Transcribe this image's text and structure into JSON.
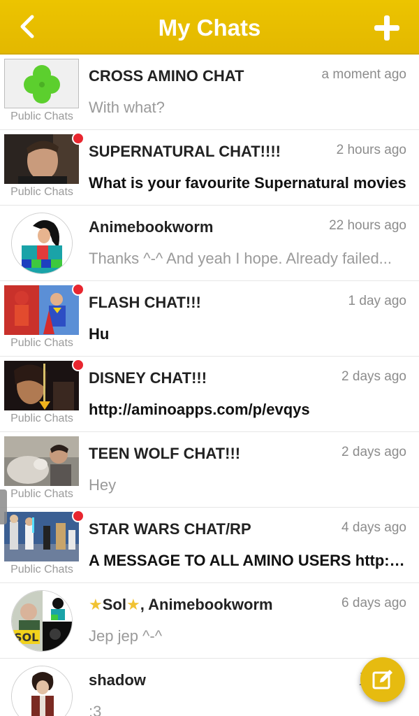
{
  "header": {
    "title": "My Chats",
    "back_icon": "chevron-left-icon",
    "add_icon": "plus-icon",
    "color": "#e3b800"
  },
  "chats": [
    {
      "name": "CROSS AMINO CHAT",
      "time": "a moment ago",
      "message": "With what?",
      "label": "Public Chats",
      "unread": false,
      "bold": false
    },
    {
      "name": "SUPERNATURAL CHAT!!!!",
      "time": "2 hours ago",
      "message": "What is your favourite Supernatural movies",
      "label": "Public Chats",
      "unread": true,
      "bold": true
    },
    {
      "name": "Animebookworm",
      "time": "22 hours ago",
      "message": "Thanks ^-^ And yeah I hope. Already failed...",
      "label": "",
      "unread": false,
      "bold": false
    },
    {
      "name": "FLASH CHAT!!!",
      "time": "1 day ago",
      "message": "Hu",
      "label": "Public Chats",
      "unread": true,
      "bold": true
    },
    {
      "name": "DISNEY CHAT!!!",
      "time": "2 days ago",
      "message": "http://aminoapps.com/p/evqys",
      "label": "Public Chats",
      "unread": true,
      "bold": true
    },
    {
      "name": "TEEN WOLF CHAT!!!",
      "time": "2 days ago",
      "message": "Hey",
      "label": "Public Chats",
      "unread": false,
      "bold": false
    },
    {
      "name": "STAR WARS CHAT/RP",
      "time": "4 days ago",
      "message": "A MESSAGE TO ALL AMINO USERS http:/...",
      "label": "Public Chats",
      "unread": true,
      "bold": true
    },
    {
      "name_part1": "Sol",
      "name_part2": ", Animebookworm",
      "time": "6 days ago",
      "message": "Jep jep ^-^",
      "label": "",
      "unread": false,
      "bold": false
    },
    {
      "name": "shadow",
      "time": "ja",
      "message": ":3",
      "label": "",
      "unread": false,
      "bold": false
    }
  ],
  "fab": {
    "icon": "compose-icon",
    "color": "#e6bb10"
  },
  "colors": {
    "unread_dot": "#e8262f",
    "muted_text": "#9a9a9a"
  }
}
